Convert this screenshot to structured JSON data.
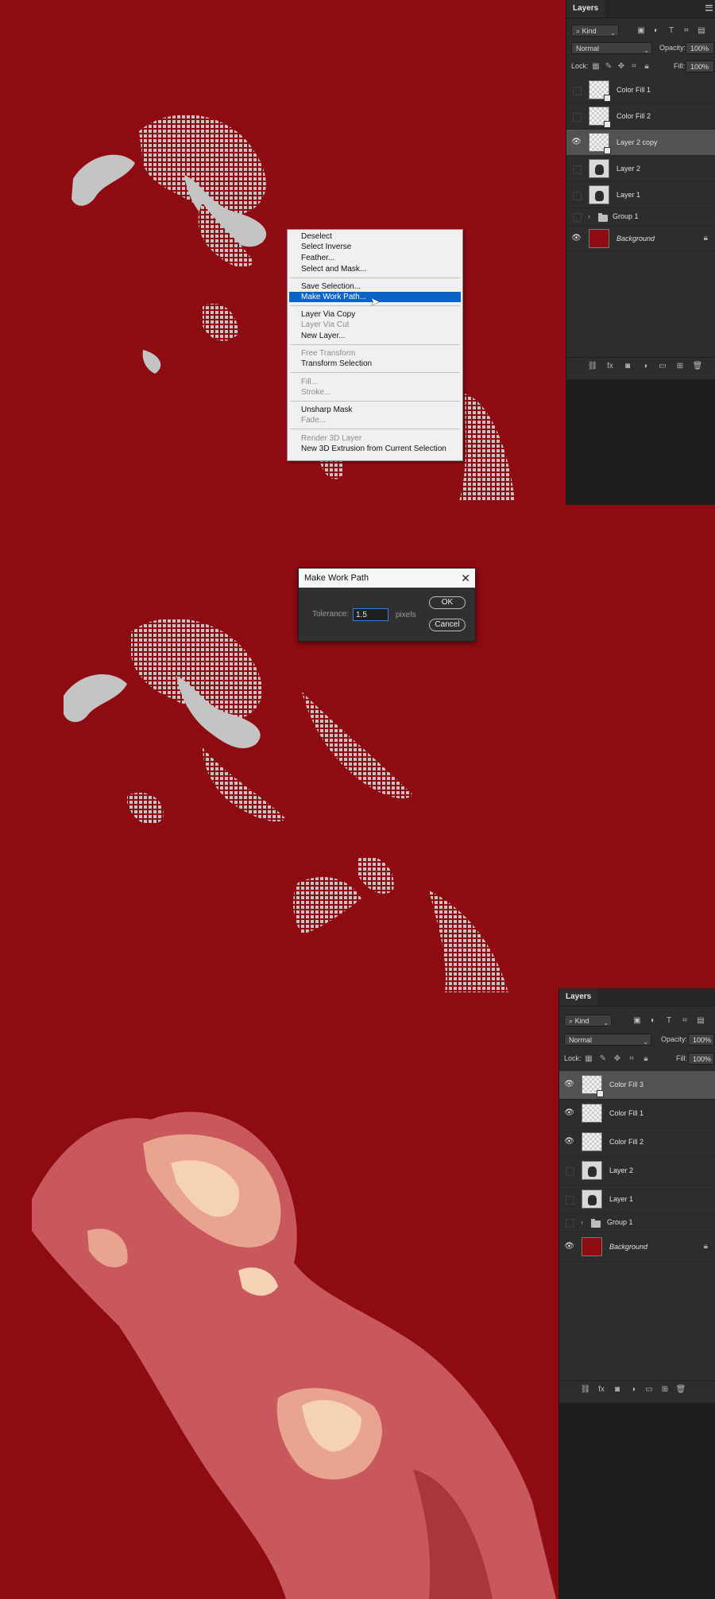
{
  "panel1": {
    "tab": "Layers",
    "filter": {
      "kind": "Kind"
    },
    "blend_mode": "Normal",
    "opacity_label": "Opacity:",
    "opacity": "100%",
    "lock_label": "Lock:",
    "fill_label": "Fill:",
    "fill": "100%",
    "layers": [
      {
        "name": "Color Fill 1",
        "visible": false
      },
      {
        "name": "Color Fill 2",
        "visible": false
      },
      {
        "name": "Layer 2 copy",
        "visible": true,
        "selected": true
      },
      {
        "name": "Layer 2",
        "visible": false
      },
      {
        "name": "Layer 1",
        "visible": false
      },
      {
        "name": "Group 1",
        "visible": false
      },
      {
        "name": "Background",
        "visible": true
      }
    ]
  },
  "context_menu": {
    "items": [
      {
        "label": "Deselect"
      },
      {
        "label": "Select Inverse"
      },
      {
        "label": "Feather..."
      },
      {
        "label": "Select and Mask..."
      },
      {
        "label": "Save Selection..."
      },
      {
        "label": "Make Work Path...",
        "highlighted": true
      },
      {
        "label": "Layer Via Copy"
      },
      {
        "label": "Layer Via Cut",
        "disabled": true
      },
      {
        "label": "New Layer..."
      },
      {
        "label": "Free Transform",
        "disabled": true
      },
      {
        "label": "Transform Selection"
      },
      {
        "label": "Fill...",
        "disabled": true
      },
      {
        "label": "Stroke...",
        "disabled": true
      },
      {
        "label": "Unsharp Mask"
      },
      {
        "label": "Fade...",
        "disabled": true
      },
      {
        "label": "Render 3D Layer",
        "disabled": true
      },
      {
        "label": "New 3D Extrusion from Current Selection"
      }
    ]
  },
  "dialog": {
    "title": "Make Work Path",
    "tolerance_label": "Tolerance:",
    "tolerance_value": "1.5",
    "unit": "pixels",
    "ok_label": "OK",
    "cancel_label": "Cancel"
  },
  "panel2": {
    "tab": "Layers",
    "filter": {
      "kind": "Kind"
    },
    "blend_mode": "Normal",
    "opacity_label": "Opacity:",
    "opacity": "100%",
    "lock_label": "Lock:",
    "fill_label": "Fill:",
    "fill": "100%",
    "layers": [
      {
        "name": "Color Fill 3",
        "visible": true,
        "selected": true
      },
      {
        "name": "Color Fill 1",
        "visible": true
      },
      {
        "name": "Color Fill 2",
        "visible": true
      },
      {
        "name": "Layer 2",
        "visible": false
      },
      {
        "name": "Layer 1",
        "visible": false
      },
      {
        "name": "Group 1",
        "visible": false
      },
      {
        "name": "Background",
        "visible": true
      }
    ]
  },
  "colors": {
    "canvas_red": "#8e0b11",
    "selection_grey": "#c4c4c4",
    "highlight_blue": "#0a64c8",
    "poster_light": "#c8585d",
    "poster_cream": "#f6d2b4",
    "poster_peach": "#e8a48f"
  },
  "icons": [
    "search-icon",
    "eye-icon",
    "lock-icon",
    "folder-icon",
    "link-icon",
    "fx-icon",
    "mask-icon",
    "adjustment-icon",
    "new-group-icon",
    "new-layer-icon",
    "trash-icon",
    "cursor-icon",
    "close-icon"
  ]
}
